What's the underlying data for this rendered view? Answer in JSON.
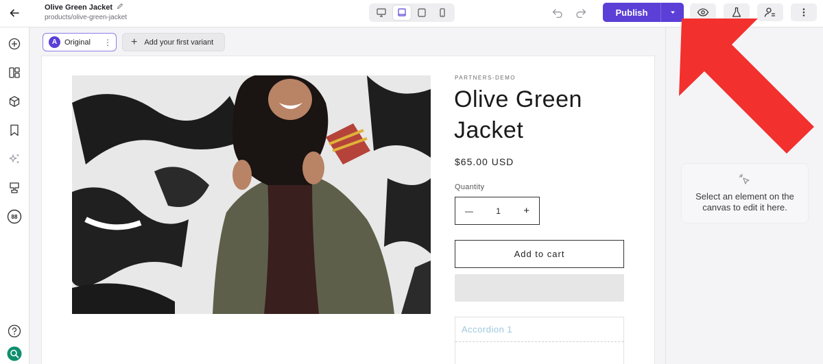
{
  "header": {
    "title": "Olive Green Jacket",
    "path": "products/olive-green-jacket",
    "publish_label": "Publish"
  },
  "variants": {
    "original_badge": "A",
    "original_label": "Original",
    "add_label": "Add your first variant"
  },
  "sidebar": {
    "score_badge": "88"
  },
  "product": {
    "vendor": "PARTNERS-DEMO",
    "title": "Olive Green Jacket",
    "price": "$65.00 USD",
    "quantity_label": "Quantity",
    "quantity_value": "1",
    "add_to_cart": "Add to cart",
    "accordion_title": "Accordion 1"
  },
  "right_panel": {
    "hint": "Select an element on the canvas to edit it here."
  },
  "colors": {
    "accent": "#5b3fd6",
    "annotation_arrow": "#f2302e"
  }
}
